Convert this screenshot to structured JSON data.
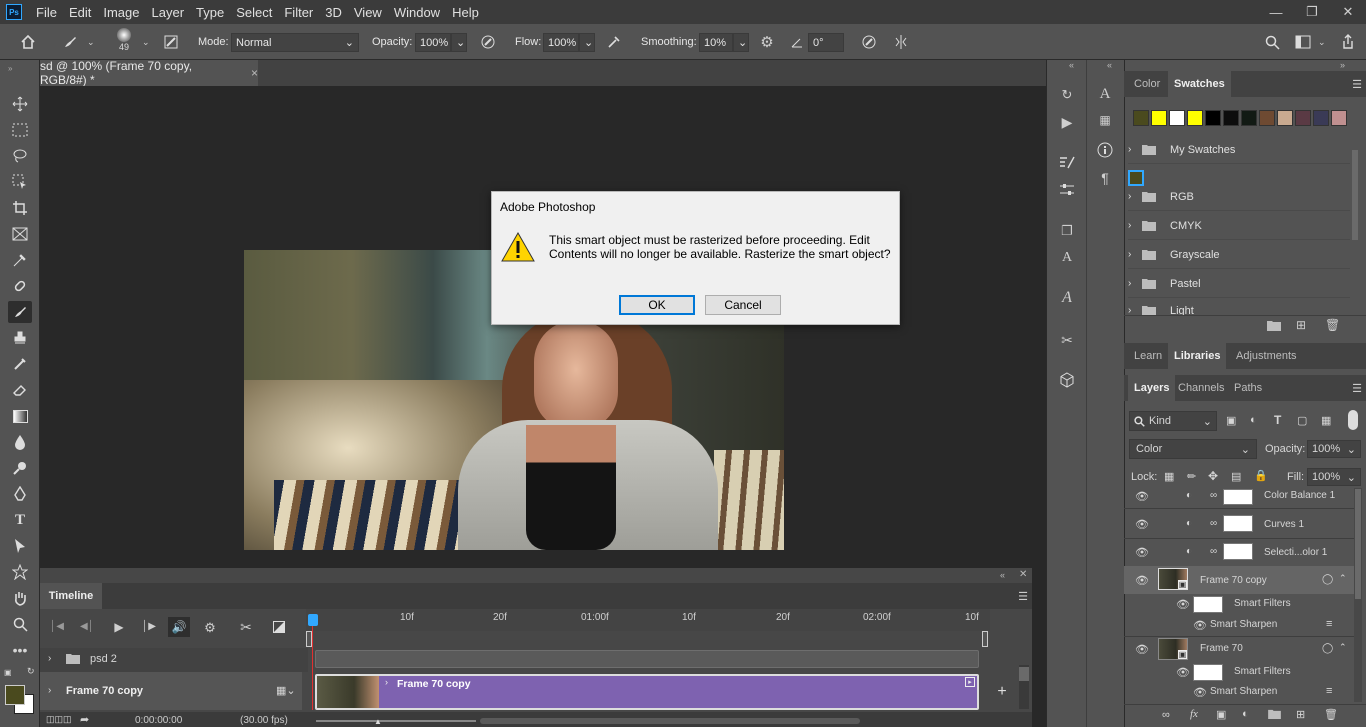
{
  "app": {
    "logo": "Ps"
  },
  "menu": [
    "File",
    "Edit",
    "Image",
    "Layer",
    "Type",
    "Select",
    "Filter",
    "3D",
    "View",
    "Window",
    "Help"
  ],
  "options": {
    "brush_size": "49",
    "mode_label": "Mode:",
    "mode_value": "Normal",
    "opacity_label": "Opacity:",
    "opacity_value": "100%",
    "flow_label": "Flow:",
    "flow_value": "100%",
    "smoothing_label": "Smoothing:",
    "smoothing_value": "10%",
    "angle_value": "0°"
  },
  "document": {
    "tab_title": "sd @ 100% (Frame 70 copy, RGB/8#) *",
    "close": "×"
  },
  "dialog": {
    "title": "Adobe Photoshop",
    "message": "This smart object must be rasterized before proceeding.  Edit Contents will no longer be available.  Rasterize the smart object?",
    "ok": "OK",
    "cancel": "Cancel",
    "icon": "warning-icon"
  },
  "timeline": {
    "title": "Timeline",
    "ruler_ticks": [
      "10f",
      "20f",
      "01:00f",
      "10f",
      "20f",
      "02:00f",
      "10f"
    ],
    "tracks": [
      {
        "name": "psd 2"
      },
      {
        "name": "Frame 70 copy",
        "clip_label": "Frame 70 copy"
      }
    ],
    "timecode": "0:00:00:00",
    "fps": "(30.00 fps)",
    "add": "+"
  },
  "swatch_panel": {
    "tabs": [
      "Color",
      "Swatches"
    ],
    "active_tab": "Swatches",
    "recent_colors": [
      "#4a4a1e",
      "#ffff00",
      "#ffffff",
      "#ffff00",
      "#000000",
      "#0d0d0d",
      "#121a14",
      "#0e1c18",
      "#6e4a32",
      "#c9aa90",
      "#5a3a44",
      "#3a3a56",
      "#3c3c5a",
      "#c09090"
    ],
    "folders": [
      "My Swatches",
      "RGB",
      "CMYK",
      "Grayscale",
      "Pastel",
      "Light"
    ],
    "selected_swatch_color": "#4a4a1e"
  },
  "library_tabs": [
    "Learn",
    "Libraries",
    "Adjustments"
  ],
  "layer_panel": {
    "tabs": [
      "Layers",
      "Channels",
      "Paths"
    ],
    "filter_kind": "Kind",
    "blend_mode": "Color",
    "opacity_label": "Opacity:",
    "opacity_value": "100%",
    "lock_label": "Lock:",
    "fill_label": "Fill:",
    "fill_value": "100%",
    "layers": [
      {
        "name": "Color Balance 1"
      },
      {
        "name": "Curves 1"
      },
      {
        "name": "Selecti...olor 1"
      },
      {
        "name": "Frame 70 copy",
        "filters_label": "Smart Filters",
        "filter": "Smart Sharpen"
      },
      {
        "name": "Frame 70",
        "filters_label": "Smart Filters",
        "filter": "Smart Sharpen"
      }
    ]
  },
  "colors": {
    "foreground": "#4a4a1e",
    "background": "#ffffff",
    "accent": "#31a8ff",
    "clip": "#7e62b0"
  }
}
